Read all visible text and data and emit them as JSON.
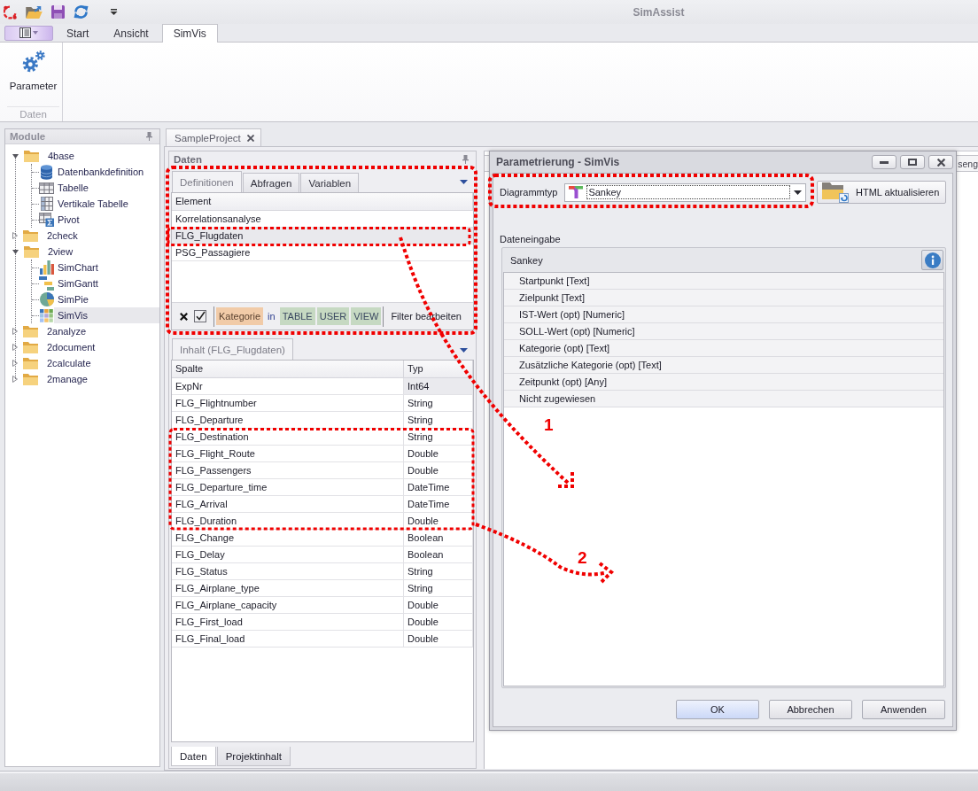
{
  "title_bar": {
    "title": "SimAssist"
  },
  "ribbon": {
    "tabs": [
      {
        "label": "Start",
        "selected": false
      },
      {
        "label": "Ansicht",
        "selected": false
      },
      {
        "label": "SimVis",
        "selected": true
      }
    ],
    "groups": [
      {
        "label": "Daten",
        "buttons": [
          {
            "label": "Parameter"
          }
        ]
      }
    ]
  },
  "module_panel": {
    "title": "Module",
    "tree": [
      {
        "label": "4base",
        "kind": "folder",
        "expanded": true,
        "selected": false,
        "children": [
          {
            "label": "Datenbankdefinition",
            "kind": "database",
            "selected": false
          },
          {
            "label": "Tabelle",
            "kind": "table",
            "selected": false
          },
          {
            "label": "Vertikale Tabelle",
            "kind": "vertical-table",
            "selected": false
          },
          {
            "label": "Pivot",
            "kind": "pivot",
            "selected": false
          }
        ]
      },
      {
        "label": "2check",
        "kind": "folder",
        "expanded": false,
        "selected": false
      },
      {
        "label": "2view",
        "kind": "folder",
        "expanded": true,
        "selected": false,
        "children": [
          {
            "label": "SimChart",
            "kind": "bar-chart",
            "selected": false
          },
          {
            "label": "SimGantt",
            "kind": "gantt",
            "selected": false
          },
          {
            "label": "SimPie",
            "kind": "pie-chart",
            "selected": false
          },
          {
            "label": "SimVis",
            "kind": "tile-grid",
            "selected": true
          }
        ]
      },
      {
        "label": "2analyze",
        "kind": "folder",
        "expanded": false,
        "selected": false
      },
      {
        "label": "2document",
        "kind": "folder",
        "expanded": false,
        "selected": false
      },
      {
        "label": "2calculate",
        "kind": "folder",
        "expanded": false,
        "selected": false
      },
      {
        "label": "2manage",
        "kind": "folder",
        "expanded": false,
        "selected": false
      }
    ]
  },
  "document_tab": {
    "label": "SampleProject"
  },
  "data_panel": {
    "title": "Daten",
    "tabs": [
      {
        "label": "Definitionen",
        "selected": true
      },
      {
        "label": "Abfragen",
        "selected": false
      },
      {
        "label": "Variablen",
        "selected": false
      }
    ],
    "element_table": {
      "columns": [
        "Element"
      ],
      "rows": [
        {
          "name": "Korrelationsanalyse",
          "selected": false
        },
        {
          "name": "FLG_Flugdaten",
          "selected": true
        },
        {
          "name": "PSG_Passagiere",
          "selected": false
        }
      ]
    },
    "filter": {
      "checked": true,
      "field": "Kategorie",
      "operator": "in",
      "values": [
        "TABLE",
        "USER",
        "VIEW"
      ],
      "edit_link": "Filter bearbeiten"
    },
    "content_tab": {
      "label": "Inhalt (FLG_Flugdaten)"
    },
    "content_table": {
      "columns": [
        "Spalte",
        "Typ"
      ],
      "rows": [
        {
          "column": "ExpNr",
          "type": "Int64",
          "focused": true
        },
        {
          "column": "FLG_Flightnumber",
          "type": "String",
          "focused": false
        },
        {
          "column": "FLG_Departure",
          "type": "String",
          "focused": false
        },
        {
          "column": "FLG_Destination",
          "type": "String",
          "focused": false
        },
        {
          "column": "FLG_Flight_Route",
          "type": "Double",
          "focused": false
        },
        {
          "column": "FLG_Passengers",
          "type": "Double",
          "focused": false
        },
        {
          "column": "FLG_Departure_time",
          "type": "DateTime",
          "focused": false
        },
        {
          "column": "FLG_Arrival",
          "type": "DateTime",
          "focused": false
        },
        {
          "column": "FLG_Duration",
          "type": "Double",
          "focused": false
        },
        {
          "column": "FLG_Change",
          "type": "Boolean",
          "focused": false
        },
        {
          "column": "FLG_Delay",
          "type": "Boolean",
          "focused": false
        },
        {
          "column": "FLG_Status",
          "type": "String",
          "focused": false
        },
        {
          "column": "FLG_Airplane_type",
          "type": "String",
          "focused": false
        },
        {
          "column": "FLG_Airplane_capacity",
          "type": "Double",
          "focused": false
        },
        {
          "column": "FLG_First_load",
          "type": "Double",
          "focused": false
        },
        {
          "column": "FLG_Final_load",
          "type": "Double",
          "focused": false
        }
      ]
    },
    "bottom_tabs": [
      {
        "label": "Daten",
        "selected": true
      },
      {
        "label": "Projektinhalt",
        "selected": false
      }
    ]
  },
  "background_panel": {
    "tab_label": "seng"
  },
  "dialog": {
    "title": "Parametrierung - SimVis",
    "chart_type_label": "Diagrammtyp",
    "chart_type": "Sankey",
    "refresh_button": "HTML aktualisieren",
    "input_label": "Dateneingabe",
    "group_title": "Sankey",
    "fields": [
      "Startpunkt [Text]",
      "Zielpunkt [Text]",
      "IST-Wert (opt) [Numeric]",
      "SOLL-Wert (opt) [Numeric]",
      "Kategorie (opt) [Text]",
      "Zusätzliche Kategorie (opt) [Text]",
      "Zeitpunkt (opt) [Any]",
      "Nicht zugewiesen"
    ],
    "buttons": [
      {
        "label": "OK",
        "default": true
      },
      {
        "label": "Abbrechen",
        "default": false
      },
      {
        "label": "Anwenden",
        "default": false
      }
    ]
  },
  "annotations": [
    {
      "label": "1"
    },
    {
      "label": "2"
    }
  ]
}
